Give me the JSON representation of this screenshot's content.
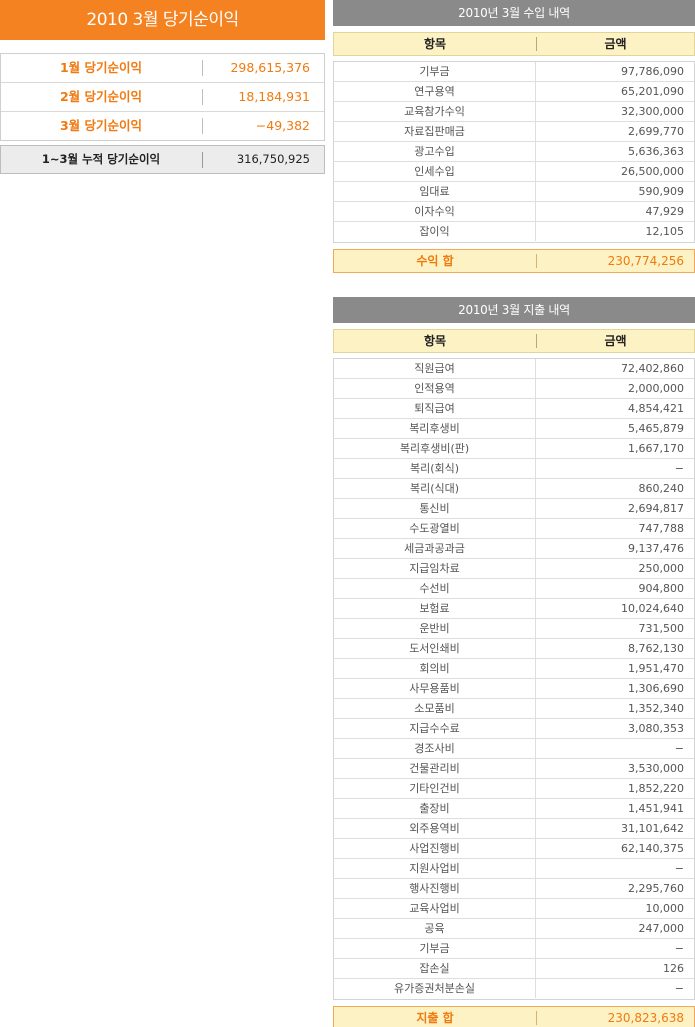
{
  "net_income": {
    "title": "2010 3월 당기순이익",
    "rows": [
      {
        "label": "1월 당기순이익",
        "value": "298,615,376"
      },
      {
        "label": "2월 당기순이익",
        "value": "18,184,931"
      },
      {
        "label": "3월 당기순이익",
        "value": "−49,382"
      }
    ],
    "total": {
      "label": "1~3월 누적 당기순이익",
      "value": "316,750,925"
    }
  },
  "income": {
    "title": "2010년 3월 수입 내역",
    "col_item": "항목",
    "col_amount": "금액",
    "rows": [
      {
        "item": "기부금",
        "amount": "97,786,090"
      },
      {
        "item": "연구용역",
        "amount": "65,201,090"
      },
      {
        "item": "교육참가수익",
        "amount": "32,300,000"
      },
      {
        "item": "자료집판매금",
        "amount": "2,699,770"
      },
      {
        "item": "광고수입",
        "amount": "5,636,363"
      },
      {
        "item": "인세수입",
        "amount": "26,500,000"
      },
      {
        "item": "임대료",
        "amount": "590,909"
      },
      {
        "item": "이자수익",
        "amount": "47,929"
      },
      {
        "item": "잡이익",
        "amount": "12,105"
      }
    ],
    "total": {
      "label": "수익 합",
      "value": "230,774,256"
    }
  },
  "expense": {
    "title": "2010년 3월 지출 내역",
    "col_item": "항목",
    "col_amount": "금액",
    "rows": [
      {
        "item": "직원급여",
        "amount": "72,402,860"
      },
      {
        "item": "인적용역",
        "amount": "2,000,000"
      },
      {
        "item": "퇴직급여",
        "amount": "4,854,421"
      },
      {
        "item": "복리후생비",
        "amount": "5,465,879"
      },
      {
        "item": "복리후생비(판)",
        "amount": "1,667,170"
      },
      {
        "item": "복리(회식)",
        "amount": "−"
      },
      {
        "item": "복리(식대)",
        "amount": "860,240"
      },
      {
        "item": "통신비",
        "amount": "2,694,817"
      },
      {
        "item": "수도광열비",
        "amount": "747,788"
      },
      {
        "item": "세금과공과금",
        "amount": "9,137,476"
      },
      {
        "item": "지급임차료",
        "amount": "250,000"
      },
      {
        "item": "수선비",
        "amount": "904,800"
      },
      {
        "item": "보험료",
        "amount": "10,024,640"
      },
      {
        "item": "운반비",
        "amount": "731,500"
      },
      {
        "item": "도서인쇄비",
        "amount": "8,762,130"
      },
      {
        "item": "회의비",
        "amount": "1,951,470"
      },
      {
        "item": "사무용품비",
        "amount": "1,306,690"
      },
      {
        "item": "소모품비",
        "amount": "1,352,340"
      },
      {
        "item": "지급수수료",
        "amount": "3,080,353"
      },
      {
        "item": "경조사비",
        "amount": "−"
      },
      {
        "item": "건물관리비",
        "amount": "3,530,000"
      },
      {
        "item": "기타인건비",
        "amount": "1,852,220"
      },
      {
        "item": "출장비",
        "amount": "1,451,941"
      },
      {
        "item": "외주용역비",
        "amount": "31,101,642"
      },
      {
        "item": "사업진행비",
        "amount": "62,140,375"
      },
      {
        "item": "지원사업비",
        "amount": "−"
      },
      {
        "item": "행사진행비",
        "amount": "2,295,760"
      },
      {
        "item": "교육사업비",
        "amount": "10,000"
      },
      {
        "item": "공육",
        "amount": "247,000"
      },
      {
        "item": "기부금",
        "amount": "−"
      },
      {
        "item": "잡손실",
        "amount": "126"
      },
      {
        "item": "유가증권처분손실",
        "amount": "−"
      }
    ],
    "total": {
      "label": "지출 합",
      "value": "230,823,638"
    }
  }
}
